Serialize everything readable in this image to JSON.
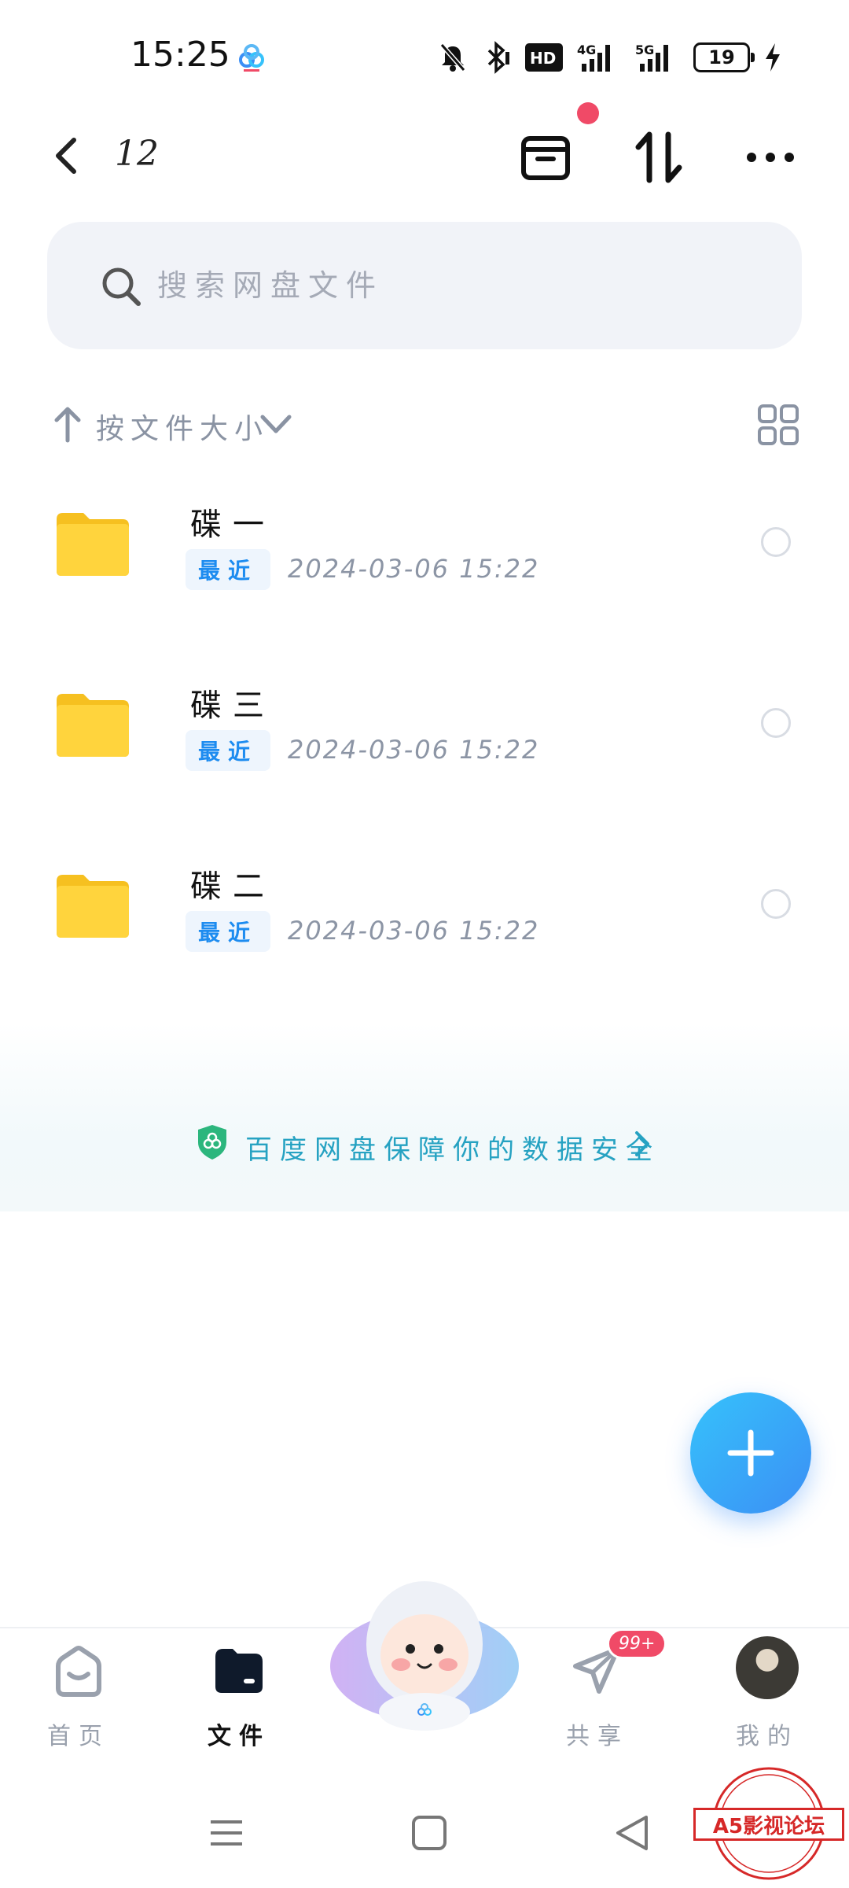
{
  "status_bar": {
    "time": "15:25",
    "network_labels": [
      "HD",
      "4G",
      "5G"
    ],
    "battery_level": "19",
    "icons": [
      "baidu-netdisk-icon",
      "mute-bell-icon",
      "bluetooth-icon",
      "charging-icon"
    ]
  },
  "header": {
    "title": "12",
    "icons": [
      "back-icon",
      "recycle-box-icon",
      "sort-icon",
      "more-icon"
    ],
    "notification_dot_color": "#f04a67"
  },
  "search": {
    "placeholder": "搜索网盘文件"
  },
  "sort_bar": {
    "label": "按文件大小",
    "direction_icon": "arrow-up-icon",
    "view_toggle_icon": "grid-view-icon"
  },
  "files": [
    {
      "name": "碟一",
      "badge": "最近",
      "date": "2024-03-06  15:22",
      "selected": false
    },
    {
      "name": "碟三",
      "badge": "最近",
      "date": "2024-03-06  15:22",
      "selected": false
    },
    {
      "name": "碟二",
      "badge": "最近",
      "date": "2024-03-06  15:22",
      "selected": false
    }
  ],
  "security_banner": {
    "text": "百度网盘保障你的数据安全",
    "color": "#26a2c2"
  },
  "fab": {
    "icon": "plus-icon",
    "gradient": [
      "#36c2fb",
      "#3b8ff5"
    ]
  },
  "bottom_nav": {
    "items": [
      {
        "label": "首页",
        "icon": "home-icon",
        "active": false
      },
      {
        "label": "文件",
        "icon": "folder-icon",
        "active": true
      },
      {
        "label": "",
        "icon": "mascot-icon",
        "active": false
      },
      {
        "label": "共享",
        "icon": "share-plane-icon",
        "active": false,
        "badge": "99+"
      },
      {
        "label": "我的",
        "icon": "avatar-icon",
        "active": false
      }
    ]
  },
  "system_nav": {
    "icons": [
      "menu-icon",
      "home-square-icon",
      "back-triangle-icon"
    ]
  },
  "watermark": {
    "text": "A5影视论坛",
    "color": "#d62828"
  }
}
